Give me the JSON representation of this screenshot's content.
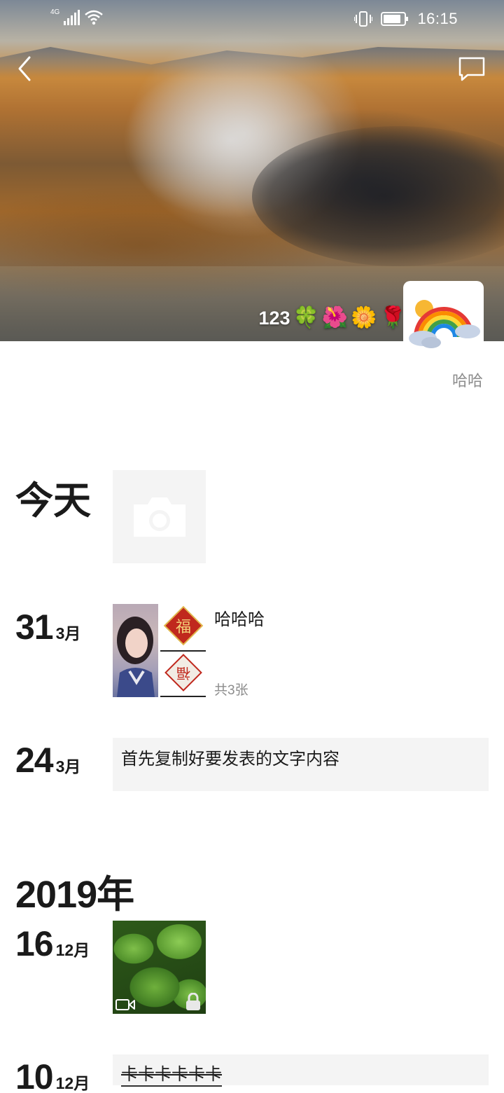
{
  "status_bar": {
    "network": "4G",
    "time": "16:15"
  },
  "header": {
    "signature_text": "123",
    "signature_emojis": [
      "🍀",
      "🌺",
      "🌼",
      "🌹"
    ],
    "nickname": "哈哈"
  },
  "timeline": {
    "today_label": "今天",
    "posts": [
      {
        "day": "31",
        "month": "3月",
        "text": "哈哈哈",
        "photo_count": "共3张"
      },
      {
        "day": "24",
        "month": "3月",
        "text": "首先复制好要发表的文字内容"
      }
    ],
    "year_label": "2019年",
    "year_posts": [
      {
        "day": "16",
        "month": "12月"
      },
      {
        "day": "10",
        "month": "12月",
        "text": "卡卡卡卡卡卡"
      }
    ]
  },
  "photo_labels": {
    "fu": "福"
  },
  "colors": {
    "background": "#ffffff",
    "card_background": "#f4f4f4",
    "secondary_text": "#8c8c8c"
  }
}
